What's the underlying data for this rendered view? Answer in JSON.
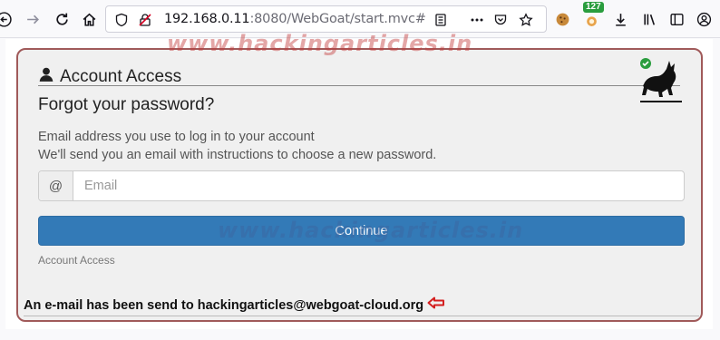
{
  "browser": {
    "url_host": "192.168.0.11",
    "url_rest": ":8080/WebGoat/start.mvc#",
    "extension_badge": "127"
  },
  "watermark": "www.hackingarticles.in",
  "panel": {
    "section_title": "Account Access",
    "heading": "Forgot your password?",
    "desc_line1": "Email address you use to log in to your account",
    "desc_line2": "We'll send you an email with instructions to choose a new password.",
    "addon_symbol": "@",
    "email_placeholder": "Email",
    "continue_label": "Continue",
    "footer_link": "Account Access"
  },
  "notice": "An e-mail has been send to hackingarticles@webgoat-cloud.org",
  "colors": {
    "primary_button": "#337ab7",
    "panel_border": "#a05a5a",
    "annotation_arrow": "#d42020",
    "check_badge": "#2a9d3e"
  }
}
